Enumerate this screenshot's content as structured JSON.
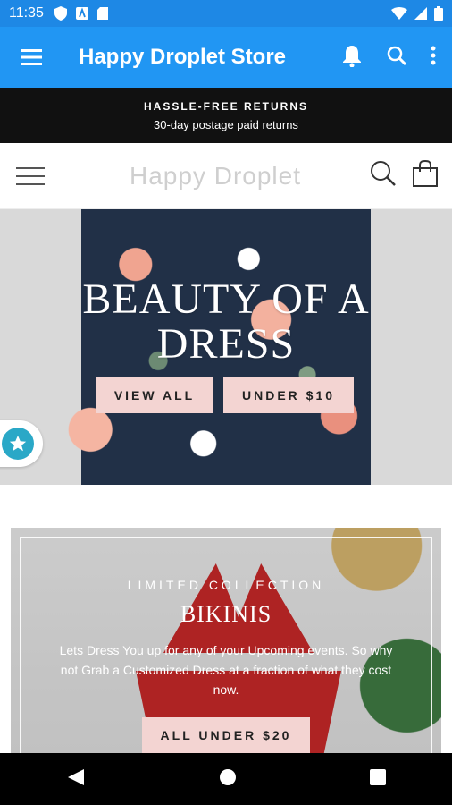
{
  "status_bar": {
    "time": "11:35"
  },
  "app_bar": {
    "title": "Happy Droplet Store"
  },
  "notice": {
    "title": "HASSLE-FREE RETURNS",
    "subtitle": "30-day postage paid returns"
  },
  "site_header": {
    "logo_text": "Happy Droplet"
  },
  "hero": {
    "title_line1": "BEAUTY OF A",
    "title_line2": "DRESS",
    "buttons": [
      {
        "label": "VIEW ALL"
      },
      {
        "label": "UNDER $10"
      }
    ]
  },
  "collection": {
    "eyebrow": "LIMITED COLLECTION",
    "title": "BIKINIS",
    "description": "Lets Dress You up for any of your Upcoming events. So why not Grab a Customized Dress at a fraction of what they cost now.",
    "button_label": "ALL UNDER $20"
  },
  "colors": {
    "status_bar": "#1e88e5",
    "app_bar": "#2196f3",
    "notice_bg": "#111111",
    "button_pink": "#f3d4d2",
    "rating_badge": "#2aa8c7"
  },
  "icons": {
    "status": [
      "shield-icon",
      "a-box-icon",
      "sd-card-icon",
      "wifi-icon",
      "signal-icon",
      "battery-icon"
    ],
    "app_bar": [
      "menu-icon",
      "bell-icon",
      "search-icon",
      "more-vertical-icon"
    ],
    "site_header": [
      "hamburger-icon",
      "search-icon",
      "shopping-bag-icon"
    ],
    "nav": [
      "back-icon",
      "home-icon",
      "recents-icon"
    ],
    "badge": "star-icon"
  }
}
